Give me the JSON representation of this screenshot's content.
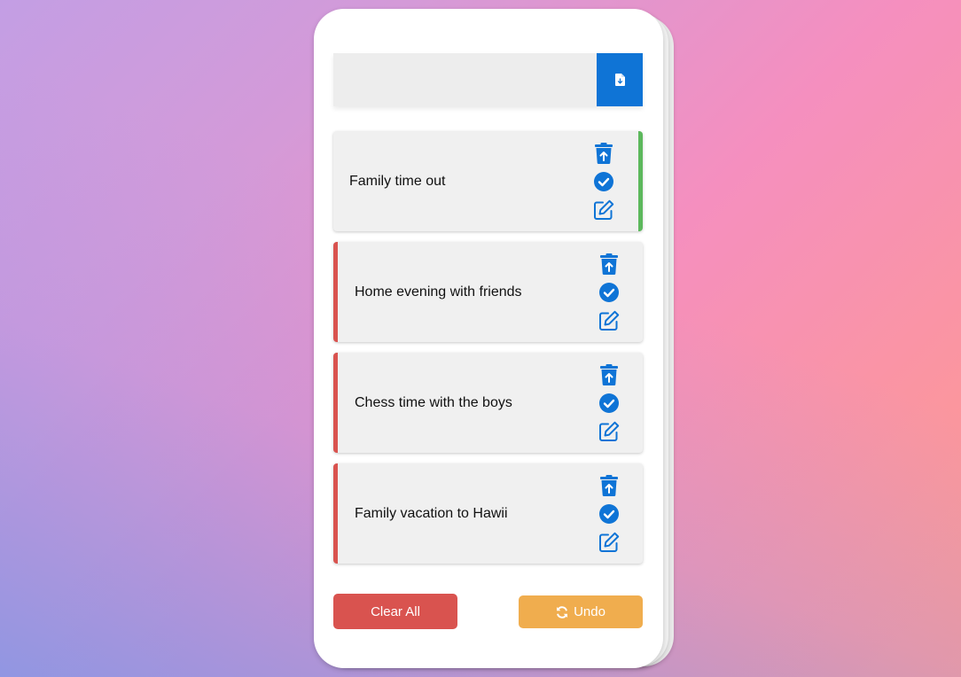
{
  "input": {
    "value": "",
    "placeholder": ""
  },
  "add_button": {
    "icon": "file-download-icon"
  },
  "tasks": [
    {
      "text": "Family time out",
      "status": "done"
    },
    {
      "text": "Home evening with friends",
      "status": "pending"
    },
    {
      "text": "Chess time with the boys",
      "status": "pending"
    },
    {
      "text": "Family vacation to Hawii",
      "status": "pending"
    }
  ],
  "actions": {
    "delete_icon": "trash-restore-icon",
    "complete_icon": "check-circle-icon",
    "edit_icon": "edit-icon"
  },
  "footer": {
    "clear_label": "Clear All",
    "undo_label": "Undo",
    "undo_icon": "sync-icon"
  },
  "colors": {
    "accent": "#0f74d6",
    "done": "#5cb85c",
    "pending": "#d9534f",
    "clear": "#d9534f",
    "undo": "#f0ad4e"
  }
}
